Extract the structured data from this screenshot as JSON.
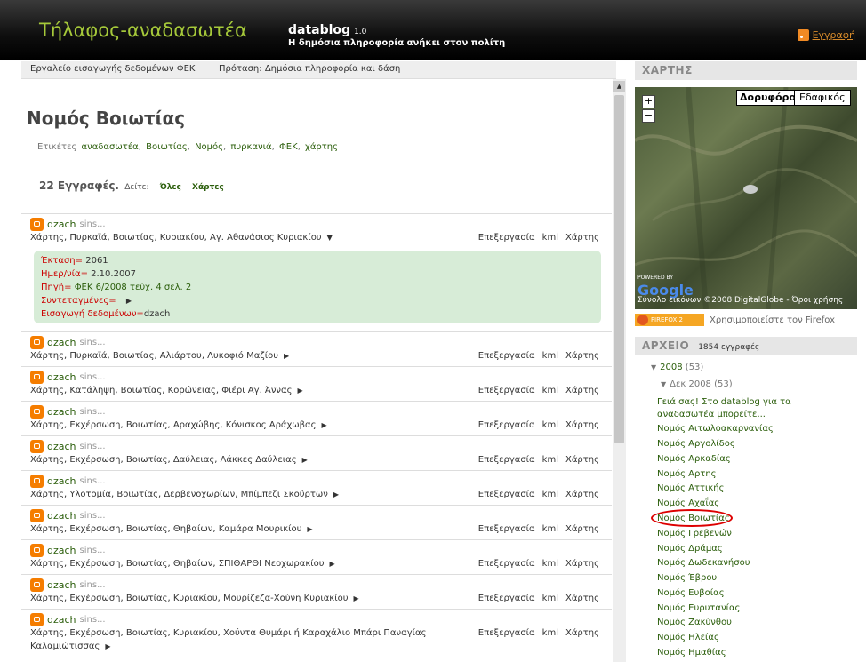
{
  "header": {
    "site_title": "Τήλαφος-αναδασωτέα",
    "brand": "datablog",
    "version": "1.0",
    "tagline": "Η δημόσια πληροφορία ανήκει στον πολίτη",
    "subscribe": "Εγγραφή"
  },
  "nav": {
    "tools": "Εργαλείο εισαγωγής δεδομένων ΦΕΚ",
    "proposal": "Πρόταση: Δημόσια πληροφορία και δάση"
  },
  "main": {
    "title": "Νομός Βοιωτίας",
    "labels_prefix": "Ετικέτες",
    "labels": [
      "αναδασωτέα",
      "Βοιωτίας",
      "Νομός",
      "πυρκανιά",
      "ΦΕΚ",
      "χάρτης"
    ],
    "count": "22 Εγγραφές.",
    "see": "Δείτε:",
    "all": "Όλες",
    "maps": "Χάρτες"
  },
  "entries": [
    {
      "author": "dzach",
      "since": "sins...",
      "desc": "Χάρτης, Πυρκαϊά, Βοιωτίας, Κυριακίου, Αγ. Αθανάσιος Κυριακίου",
      "arrow": "▼"
    },
    {
      "author": "dzach",
      "since": "sins...",
      "desc": "Χάρτης, Πυρκαϊά, Βοιωτίας, Αλιάρτου, Λυκοφιό Μαζίου",
      "arrow": "▶"
    },
    {
      "author": "dzach",
      "since": "sins...",
      "desc": "Χάρτης, Κατάληψη, Βοιωτίας, Κορώνειας, Φιέρι Αγ. Άννας",
      "arrow": "▶"
    },
    {
      "author": "dzach",
      "since": "sins...",
      "desc": "Χάρτης, Εκχέρσωση, Βοιωτίας, Αραχώβης, Κόνισκος Αράχωβας",
      "arrow": "▶"
    },
    {
      "author": "dzach",
      "since": "sins...",
      "desc": "Χάρτης, Εκχέρσωση, Βοιωτίας, Δαύλειας, Λάκκες Δαύλειας",
      "arrow": "▶"
    },
    {
      "author": "dzach",
      "since": "sins...",
      "desc": "Χάρτης, Υλοτομία, Βοιωτίας, Δερβενοχωρίων, Μπίμπεζι Σκούρτων",
      "arrow": "▶"
    },
    {
      "author": "dzach",
      "since": "sins...",
      "desc": "Χάρτης, Εκχέρσωση, Βοιωτίας, Θηβαίων, Καμάρα Μουρικίου",
      "arrow": "▶"
    },
    {
      "author": "dzach",
      "since": "sins...",
      "desc": "Χάρτης, Εκχέρσωση, Βοιωτίας, Θηβαίων, ΣΠΙΘΑΡΘΙ Νεοχωρακίου",
      "arrow": "▶"
    },
    {
      "author": "dzach",
      "since": "sins...",
      "desc": "Χάρτης, Εκχέρσωση, Βοιωτίας, Κυριακίου, Μουρίζεζα-Χούνη Κυριακίου",
      "arrow": "▶"
    },
    {
      "author": "dzach",
      "since": "sins...",
      "desc": "Χάρτης, Εκχέρσωση, Βοιωτίας, Κυριακίου, Χούντα Θυμάρι ή Καραχάλιο Μπάρι Παναγίας",
      "desc2": "Καλαμιώτισσας",
      "arrow": "▶"
    }
  ],
  "actions": {
    "edit": "Επεξεργασία",
    "kml": "kml",
    "map": "Χάρτης"
  },
  "detail": {
    "area_label": "Έκταση=",
    "area": "2061",
    "date_label": "Ημερ/νία=",
    "date": "2.10.2007",
    "source_label": "Πηγή=",
    "source": "ΦΕΚ 6/2008 τεύχ. 4 σελ. 2",
    "coords_label": "Συντεταγμένες=",
    "coords_arrow": "▶",
    "entry_label": "Εισαγωγή δεδομένων=",
    "entry": "dzach"
  },
  "sidebar": {
    "map_title": "ΧΑΡΤΗΣ",
    "zoom_in": "+",
    "zoom_out": "−",
    "satellite": "Δορυφόρος",
    "terrain": "Εδαφικός",
    "google": "Google",
    "powered": "POWERED BY",
    "credit": "Σύνολο εικόνων ©2008 DigitalGlobe - Όροι χρήσης",
    "firefox_badge": "FIREFOX 2",
    "firefox_text": "Χρησιμοποιείστε τον Firefox",
    "archive_title": "ΑΡΧΕΙΟ",
    "archive_count": "1854 εγγραφές",
    "year": "2008",
    "year_count": "(53)",
    "month": "Δεκ 2008",
    "month_count": "(53)",
    "intro": "Γειά σας! Στο datablog για τα αναδασωτέα μπορείτε...",
    "items": [
      "Νομός Αιτωλοακαρνανίας",
      "Νομός Αργολίδος",
      "Νομός Αρκαδίας",
      "Νομός Αρτης",
      "Νομός Αττικής",
      "Νομός Αχαΐας",
      "Νομός Βοιωτίας",
      "Νομός Γρεβενών",
      "Νομός Δράμας",
      "Νομός Δωδεκανήσου",
      "Νομός Έβρου",
      "Νομός Ευβοίας",
      "Νομός Ευρυτανίας",
      "Νομός Ζακύνθου",
      "Νομός Ηλείας",
      "Νομός Ημαθίας"
    ]
  },
  "colors": {
    "accent": "#a6c93a",
    "link": "#2a5d0a",
    "highlight": "#d7ecd7",
    "label_red": "#cc0000"
  }
}
